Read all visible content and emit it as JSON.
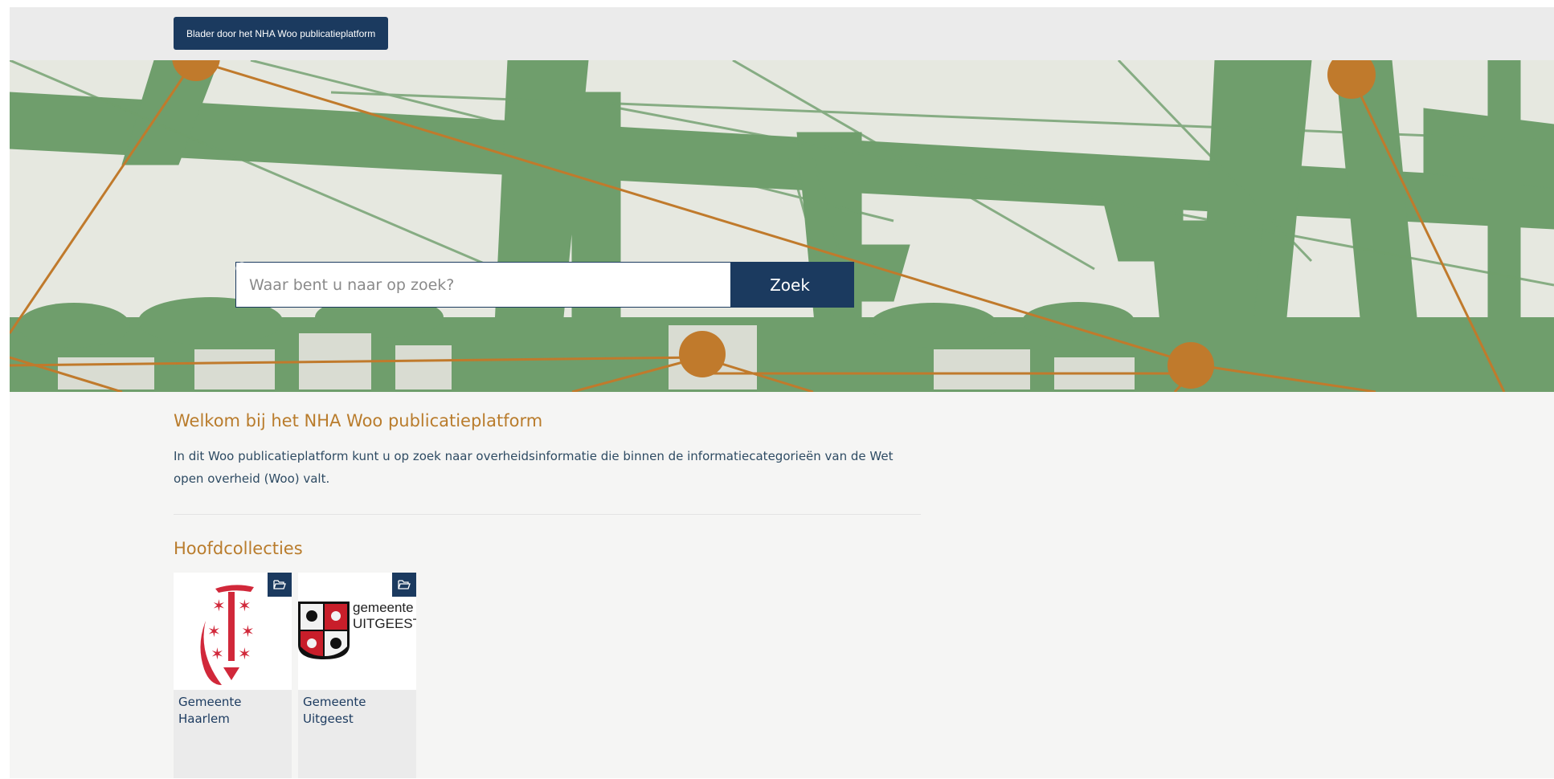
{
  "topbar": {
    "browse_button": "Blader door het NHA Woo publicatieplatform"
  },
  "hero": {
    "search_placeholder": "Waar bent u naar op zoek?",
    "search_button": "Zoek",
    "search_icon": "search-icon"
  },
  "welcome": {
    "title": "Welkom bij het NHA Woo publicatieplatform",
    "text": "In dit Woo publicatieplatform kunt u op zoek naar overheidsinformatie die binnen de informatiecategorieën van de Wet open overheid (Woo) valt."
  },
  "collections": {
    "title": "Hoofdcollecties",
    "items": [
      {
        "label": "Gemeente Haarlem",
        "icon": "folder-open-icon"
      },
      {
        "label": "Gemeente Uitgeest",
        "icon": "folder-open-icon",
        "logo_text_1": "gemeente",
        "logo_text_2": "UITGEEST"
      }
    ]
  },
  "colors": {
    "navy": "#1b3a5f",
    "accent_orange": "#b97c2c",
    "hero_green": "#6f9e6c"
  }
}
